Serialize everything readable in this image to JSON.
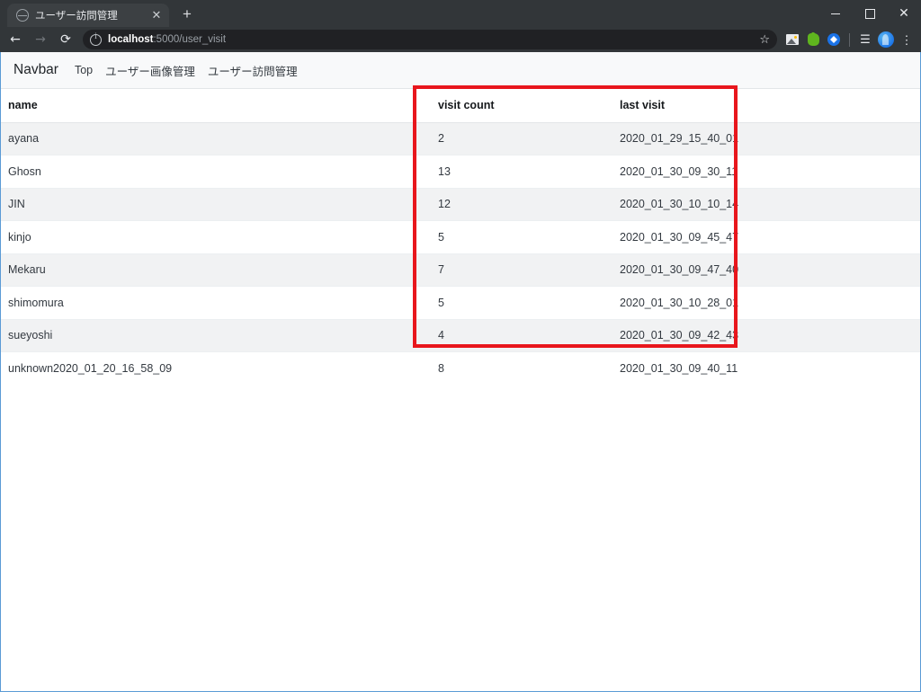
{
  "browser": {
    "tab": {
      "title": "ユーザー訪問管理",
      "favicon": "globe-icon",
      "close_label": "✕"
    },
    "new_tab_label": "+",
    "window_controls": {
      "minimize": "minimize-icon",
      "maximize": "maximize-icon",
      "close": "✕"
    },
    "nav": {
      "back": "←",
      "forward": "→",
      "reload": "⟳"
    },
    "omnibox": {
      "site_info_icon": "info-circle-icon",
      "url_host": "localhost",
      "url_rest": ":5000/user_visit",
      "bookmark_star": "☆"
    },
    "toolbar_icons": [
      "photos-extension-icon",
      "evernote-extension-icon",
      "blue-diamond-extension-icon",
      "reading-list-icon",
      "profile-avatar",
      "chrome-menu-icon"
    ],
    "menu_glyph": "⋮",
    "list_glyph": "☰"
  },
  "page": {
    "navbar": {
      "brand": "Navbar",
      "links": [
        {
          "label": "Top"
        },
        {
          "label": "ユーザー画像管理"
        },
        {
          "label": "ユーザー訪問管理"
        }
      ]
    },
    "table": {
      "columns": [
        "name",
        "visit count",
        "last visit"
      ],
      "rows": [
        {
          "name": "ayana",
          "visit_count": "2",
          "last_visit": "2020_01_29_15_40_01"
        },
        {
          "name": "Ghosn",
          "visit_count": "13",
          "last_visit": "2020_01_30_09_30_11"
        },
        {
          "name": "JIN",
          "visit_count": "12",
          "last_visit": "2020_01_30_10_10_14"
        },
        {
          "name": "kinjo",
          "visit_count": "5",
          "last_visit": "2020_01_30_09_45_47"
        },
        {
          "name": "Mekaru",
          "visit_count": "7",
          "last_visit": "2020_01_30_09_47_40"
        },
        {
          "name": "shimomura",
          "visit_count": "5",
          "last_visit": "2020_01_30_10_28_01"
        },
        {
          "name": "sueyoshi",
          "visit_count": "4",
          "last_visit": "2020_01_30_09_42_43"
        },
        {
          "name": "unknown2020_01_20_16_58_09",
          "visit_count": "8",
          "last_visit": "2020_01_30_09_40_11"
        }
      ]
    }
  },
  "annotation": {
    "type": "rectangle-highlight",
    "color": "#e8161c"
  }
}
